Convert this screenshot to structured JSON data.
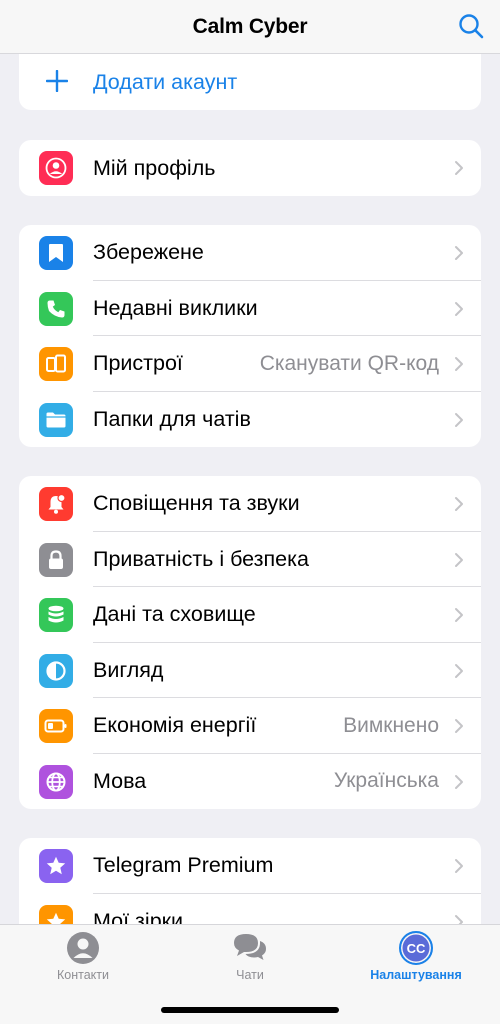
{
  "header": {
    "title": "Calm Cyber",
    "search_icon": "search-icon"
  },
  "account": {
    "add_label": "Додати акаунт"
  },
  "profile": {
    "label": "Мій профіль"
  },
  "group1": [
    {
      "label": "Збережене",
      "value": "",
      "icon": "bookmark-icon",
      "color": "#1a82e8"
    },
    {
      "label": "Недавні виклики",
      "value": "",
      "icon": "phone-icon",
      "color": "#34c759"
    },
    {
      "label": "Пристрої",
      "value": "Сканувати QR-код",
      "icon": "devices-icon",
      "color": "#ff9500"
    },
    {
      "label": "Папки для чатів",
      "value": "",
      "icon": "folder-icon",
      "color": "#32ade6"
    }
  ],
  "group2": [
    {
      "label": "Сповіщення та звуки",
      "value": "",
      "icon": "bell-icon",
      "color": "#ff3b30"
    },
    {
      "label": "Приватність і безпека",
      "value": "",
      "icon": "lock-icon",
      "color": "#8e8e93"
    },
    {
      "label": "Дані та сховище",
      "value": "",
      "icon": "database-icon",
      "color": "#34c759"
    },
    {
      "label": "Вигляд",
      "value": "",
      "icon": "appearance-icon",
      "color": "#32ade6"
    },
    {
      "label": "Економія енергії",
      "value": "Вимкнено",
      "icon": "battery-icon",
      "color": "#ff9500"
    },
    {
      "label": "Мова",
      "value": "Українська",
      "icon": "globe-icon",
      "color": "#af52de"
    }
  ],
  "group3": [
    {
      "label": "Telegram Premium",
      "value": "",
      "icon": "premium-star-icon",
      "color": "#8a63f0"
    },
    {
      "label": "Мої зірки",
      "value": "",
      "icon": "stars-icon",
      "color": "#ff9500"
    }
  ],
  "tabbar": {
    "contacts": "Контакти",
    "chats": "Чати",
    "settings": "Налаштування",
    "settings_avatar": "CC"
  },
  "colors": {
    "accent": "#1a82e8",
    "profile_icon": "#ff2d55"
  }
}
